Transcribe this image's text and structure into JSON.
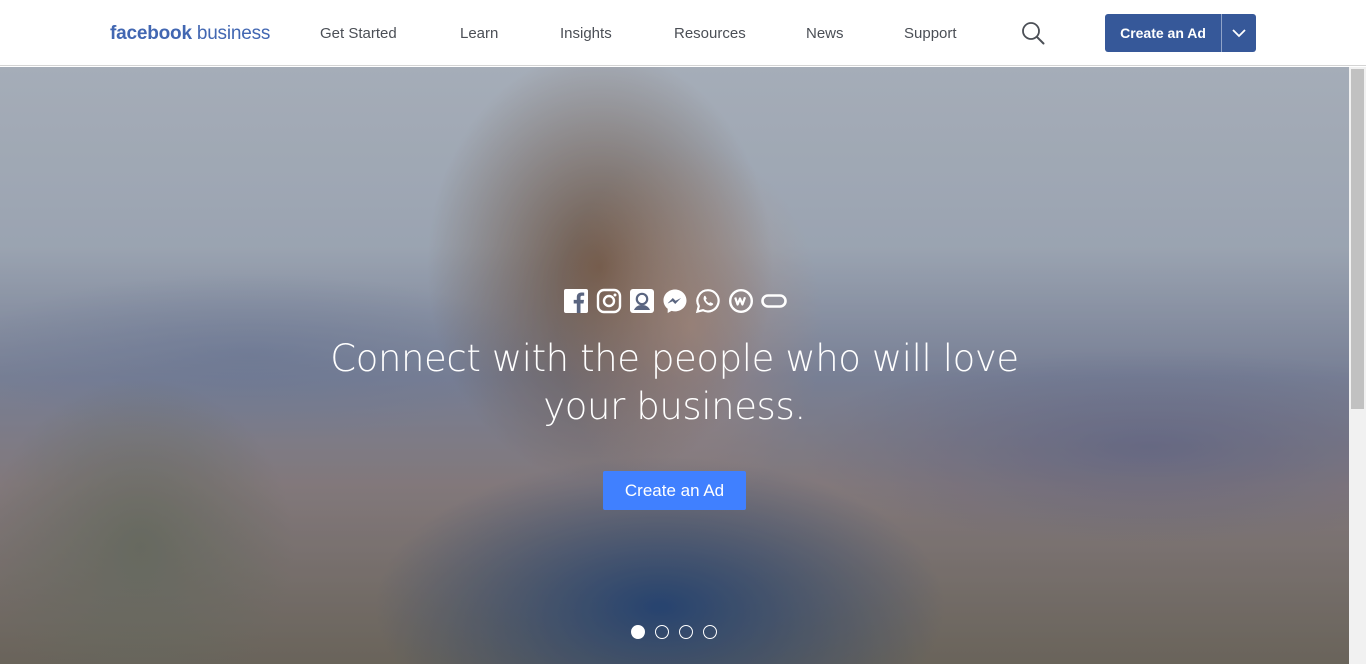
{
  "header": {
    "logo": {
      "brand": "facebook",
      "word": "business"
    },
    "nav": [
      {
        "label": "Get Started"
      },
      {
        "label": "Learn"
      },
      {
        "label": "Insights"
      },
      {
        "label": "Resources"
      },
      {
        "label": "News"
      },
      {
        "label": "Support"
      }
    ],
    "cta_label": "Create an Ad"
  },
  "hero": {
    "app_icons": [
      "facebook-icon",
      "instagram-icon",
      "audience-network-icon",
      "messenger-icon",
      "whatsapp-icon",
      "workplace-icon",
      "oculus-icon"
    ],
    "headline": "Connect with the people who will love your business.",
    "cta_label": "Create an Ad",
    "carousel": {
      "slides": 4,
      "active_slide": 1
    }
  },
  "colors": {
    "brand": "#4267b2",
    "nav_cta": "#365899",
    "hero_cta": "#4080ff",
    "nav_text": "#4b4f56"
  }
}
